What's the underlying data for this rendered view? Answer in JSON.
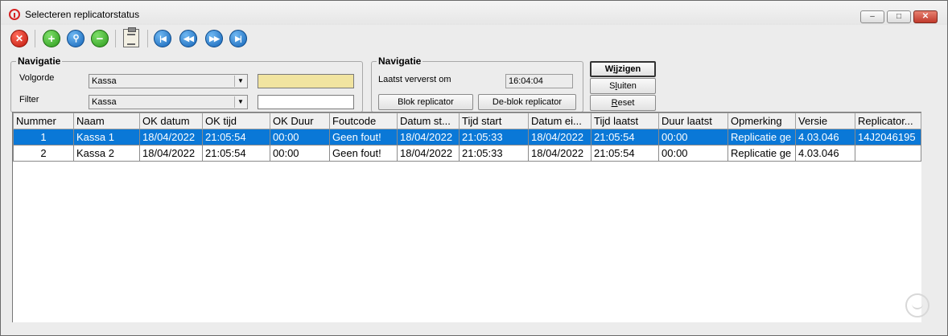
{
  "window": {
    "title": "Selecteren replicatorstatus"
  },
  "nav1": {
    "legend": "Navigatie",
    "volgorde_label": "Volgorde",
    "volgorde_value": "Kassa",
    "filter_label": "Filter",
    "filter_value": "Kassa",
    "search_value": "",
    "filter_text_value": ""
  },
  "nav2": {
    "legend": "Navigatie",
    "refresh_label": "Laatst ververst om",
    "refresh_time": "16:04:04",
    "block_button": "Blok replicator",
    "unblock_button": "De-blok replicator"
  },
  "actions": {
    "wijzigen_pre": "W",
    "wijzigen_key": "i",
    "wijzigen_post": "jzigen",
    "sluiten_pre": "S",
    "sluiten_key": "l",
    "sluiten_post": "uiten",
    "reset_key": "R",
    "reset_post": "eset"
  },
  "table": {
    "columns": [
      "Nummer",
      "Naam",
      "OK datum",
      "OK tijd",
      "OK Duur",
      "Foutcode",
      "Datum st...",
      "Tijd start",
      "Datum ei...",
      "Tijd laatst",
      "Duur laatst",
      "Opmerking",
      "Versie",
      "Replicator..."
    ],
    "rows": [
      [
        "1",
        "Kassa 1",
        "18/04/2022",
        "21:05:54",
        "00:00",
        "Geen fout!",
        "18/04/2022",
        "21:05:33",
        "18/04/2022",
        "21:05:54",
        "00:00",
        "Replicatie ge",
        "4.03.046",
        "14J2046195"
      ],
      [
        "2",
        "Kassa 2",
        "18/04/2022",
        "21:05:54",
        "00:00",
        "Geen fout!",
        "18/04/2022",
        "21:05:33",
        "18/04/2022",
        "21:05:54",
        "00:00",
        "Replicatie ge",
        "4.03.046",
        ""
      ]
    ],
    "selected_row": 0
  },
  "colors": {
    "selection": "#0a78d7",
    "highlight_input": "#f1e4a0"
  },
  "toolbar": {
    "icons": [
      "close-record-icon",
      "add-icon",
      "search-icon",
      "remove-icon",
      "clipboard-edit-icon",
      "first-record-icon",
      "previous-record-icon",
      "next-record-icon",
      "last-record-icon"
    ]
  }
}
